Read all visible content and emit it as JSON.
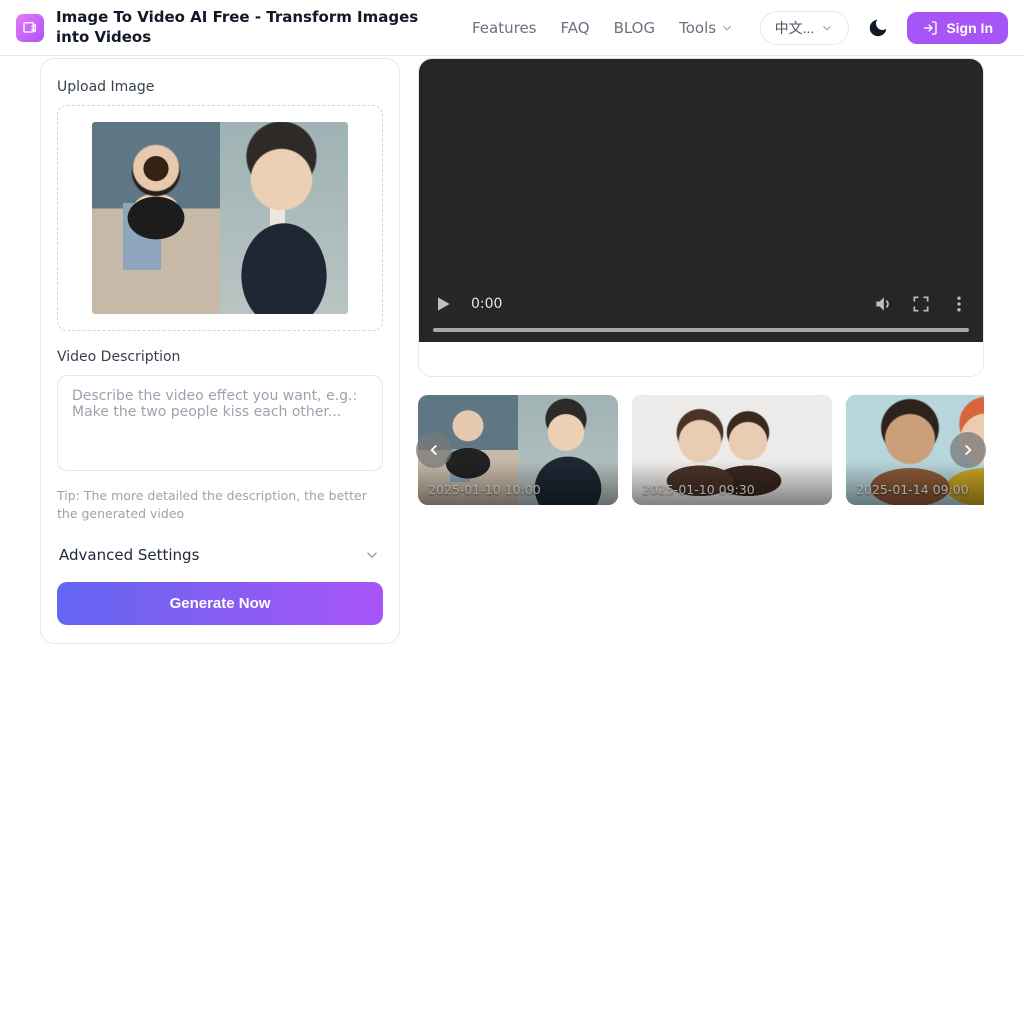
{
  "header": {
    "title": "Image To Video AI Free - Transform Images into Videos",
    "nav": {
      "features": "Features",
      "faq": "FAQ",
      "blog": "BLOG",
      "tools": "Tools"
    },
    "lang_label": "中文...",
    "signin": "Sign In"
  },
  "left": {
    "upload_label": "Upload Image",
    "desc_label": "Video Description",
    "desc_placeholder": "Describe the video effect you want, e.g.: Make the two people kiss each other...",
    "tip": "Tip: The more detailed the description, the better the generated video",
    "adv": "Advanced Settings",
    "generate": "Generate Now"
  },
  "player": {
    "time": "0:00"
  },
  "thumbs": [
    {
      "ts": "2025-01-10 10:00"
    },
    {
      "ts": "2025-01-10 09:30"
    },
    {
      "ts": "2025-01-14 09:00"
    }
  ]
}
